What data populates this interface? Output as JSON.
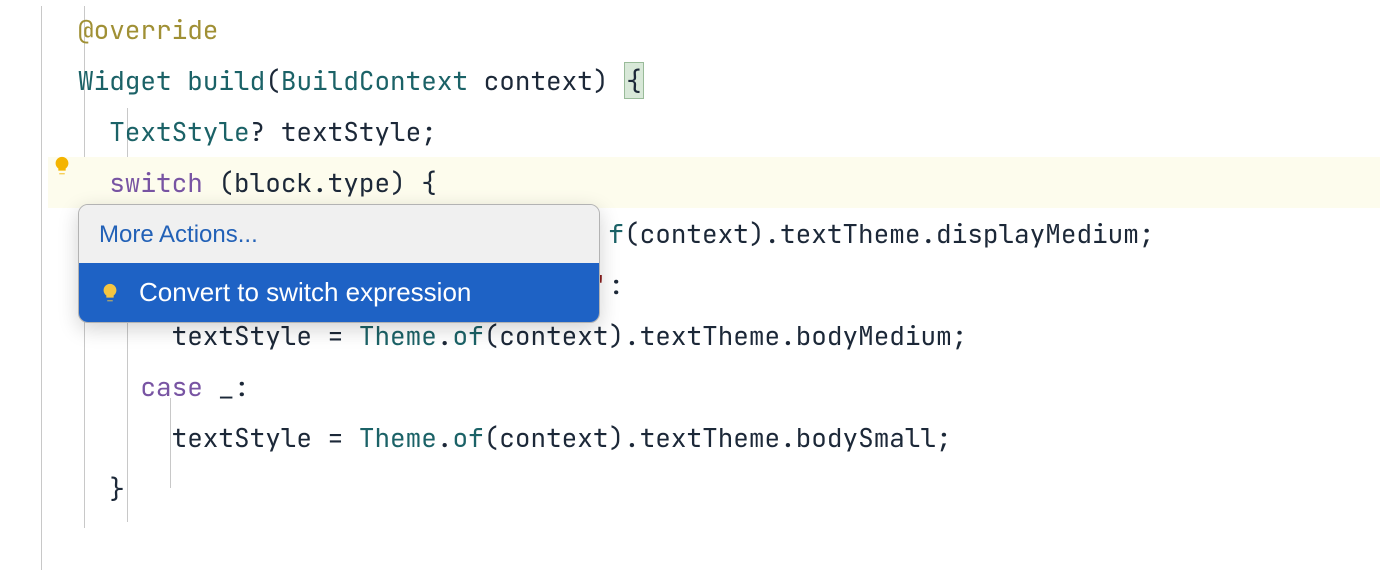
{
  "gutter": {
    "bulb_icon": "lightbulb"
  },
  "code": {
    "l1": {
      "annotation": "@override"
    },
    "l2": {
      "type": "Widget",
      "method": "build",
      "param_type": "BuildContext",
      "param_name": "context",
      "open_brace": "{"
    },
    "l3": {
      "type": "TextStyle",
      "nullable": "?",
      "var": "textStyle",
      "semi": ";"
    },
    "l4": {
      "kw": "switch",
      "expr_obj": "block",
      "expr_prop": "type",
      "open_brace": "{"
    },
    "l5": {
      "suffix_method": "f",
      "suffix_expr_arg": "context",
      "suffix_chain1": "textTheme",
      "suffix_chain2": "displayMedium",
      "semi": ";"
    },
    "l6": {
      "colon": ":"
    },
    "l7": {
      "var": "textStyle",
      "eq": "=",
      "class": "Theme",
      "method": "of",
      "arg": "context",
      "chain1": "textTheme",
      "chain2": "bodyMedium",
      "semi": ";"
    },
    "l8": {
      "kw": "case",
      "underscore": "_",
      "colon": ":"
    },
    "l9": {
      "var": "textStyle",
      "eq": "=",
      "class": "Theme",
      "method": "of",
      "arg": "context",
      "chain1": "textTheme",
      "chain2": "bodySmall",
      "semi": ";"
    },
    "l10": {
      "close_brace": "}"
    }
  },
  "popup": {
    "header": "More Actions...",
    "item": "Convert to switch expression"
  }
}
